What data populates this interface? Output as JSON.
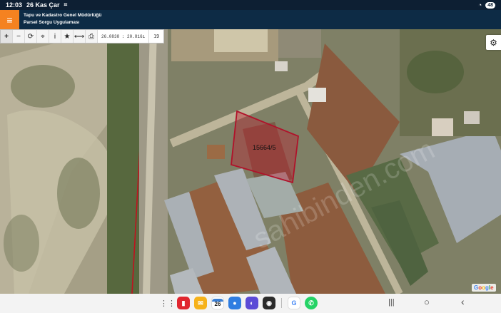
{
  "status_bar": {
    "time": "12:03",
    "date": "26 Kas Çar",
    "battery": "48"
  },
  "app": {
    "title_line1": "Tapu ve Kadastro Genel Müdürlüğü",
    "title_line2": "Parsel Sorgu Uygulaması",
    "accent_color": "#f58220",
    "header_color": "#0d2b45"
  },
  "toolbar": {
    "icons": [
      "zoom-in-icon",
      "zoom-out-icon",
      "refresh-icon",
      "locate-icon",
      "info-icon",
      "favorite-icon",
      "measure-icon",
      "print-icon"
    ],
    "coordinates": "26.0838 : 20.816ı",
    "zoom_level": "19"
  },
  "map": {
    "parcel_label": "15664/5",
    "parcel_color": "#c0182e",
    "watermark": "sahibinden.com",
    "attribution": "Google"
  },
  "dock": {
    "calendar_day": "26",
    "apps": [
      "notes-app-icon",
      "email-app-icon",
      "calendar-app-icon",
      "messages-app-icon",
      "internet-app-icon",
      "camera-app-icon",
      "google-app-icon",
      "whatsapp-app-icon"
    ]
  },
  "nav": {
    "recents": "|||",
    "home": "○",
    "back": "‹"
  }
}
